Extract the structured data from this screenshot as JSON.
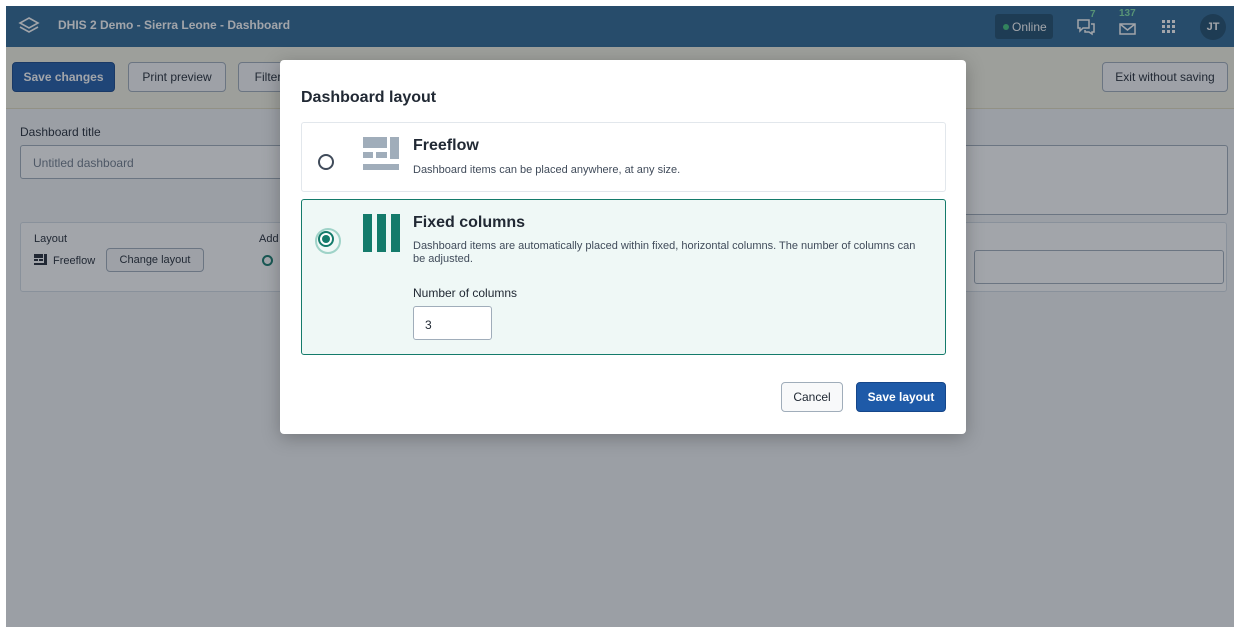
{
  "header": {
    "app_title": "DHIS 2 Demo - Sierra Leone - Dashboard",
    "online_label": "Online",
    "interpretations_count": "7",
    "messages_count": "137",
    "user_initials": "JT"
  },
  "toolbar": {
    "save_label": "Save changes",
    "print_label": "Print preview",
    "filter_label": "Filter",
    "exit_label": "Exit without saving"
  },
  "form": {
    "title_label": "Dashboard title",
    "title_placeholder": "Untitled dashboard",
    "layout_label": "Layout",
    "layout_value": "Freeflow",
    "change_layout_label": "Change layout",
    "add_label": "Add"
  },
  "modal": {
    "title": "Dashboard layout",
    "options": [
      {
        "title": "Freeflow",
        "description": "Dashboard items can be placed anywhere, at any size.",
        "selected": false
      },
      {
        "title": "Fixed columns",
        "description": "Dashboard items are automatically placed within fixed, horizontal columns. The number of columns can be adjusted.",
        "selected": true
      }
    ],
    "columns_label": "Number of columns",
    "columns_value": "3",
    "cancel_label": "Cancel",
    "save_label": "Save layout"
  },
  "colors": {
    "header_bg": "#2c6693",
    "primary": "#1e5aa8",
    "accent": "#147b6b",
    "toolbar_bg": "#f7f4e6"
  },
  "icons": {
    "logo": "dhis2-logo-icon",
    "interpretations": "interpretations-icon",
    "messages": "messages-icon",
    "apps": "apps-grid-icon",
    "freeflow": "freeflow-layout-icon",
    "fixed_columns": "fixed-columns-layout-icon"
  }
}
